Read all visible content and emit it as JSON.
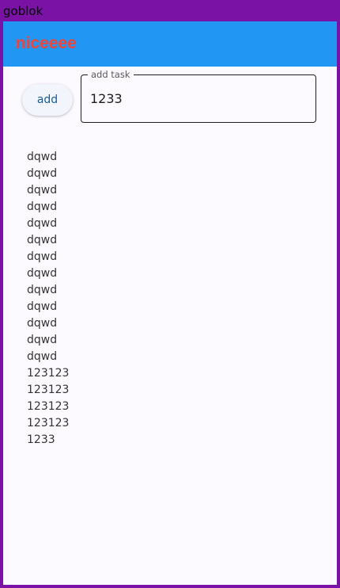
{
  "window": {
    "title": "goblok"
  },
  "app_bar": {
    "title": "niceeee",
    "background_color": "#2196f3",
    "title_color": "#f44336"
  },
  "form": {
    "add_button_label": "add",
    "task_field_label": "add task",
    "task_field_value": "1233"
  },
  "tasks": [
    "dqwd",
    "dqwd",
    "dqwd",
    "dqwd",
    "dqwd",
    "dqwd",
    "dqwd",
    "dqwd",
    "dqwd",
    "dqwd",
    "dqwd",
    "dqwd",
    "dqwd",
    "123123",
    "123123",
    "123123",
    "123123",
    "1233"
  ]
}
